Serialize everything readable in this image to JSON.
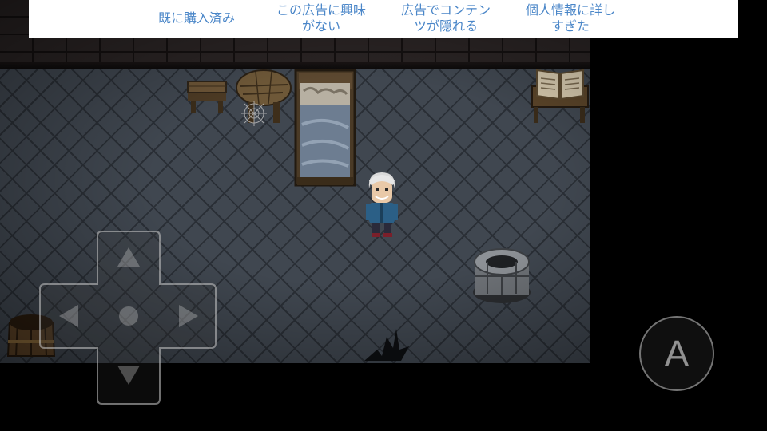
{
  "ad_banner": {
    "options": [
      {
        "line1": "既に購入済み",
        "line2": ""
      },
      {
        "line1": "この広告に興味",
        "line2": "がない"
      },
      {
        "line1": "広告でコンテン",
        "line2": "ツが隠れる"
      },
      {
        "line1": "個人情報に詳し",
        "line2": "すぎた"
      }
    ],
    "text_color": "#4a86c8"
  },
  "controls": {
    "dpad": {
      "up": "up-arrow-icon",
      "down": "down-arrow-icon",
      "left": "left-arrow-icon",
      "right": "right-arrow-icon"
    },
    "action_button_label": "A"
  },
  "scene": {
    "floor_color": "#404750",
    "wall_color": "#2a2424",
    "character": "old man with white hair, blue jacket",
    "objects": [
      "small-table",
      "round-table",
      "spider-web",
      "bed",
      "open-book-shelf",
      "stone-well",
      "broken-barrel",
      "floor-crack"
    ]
  }
}
